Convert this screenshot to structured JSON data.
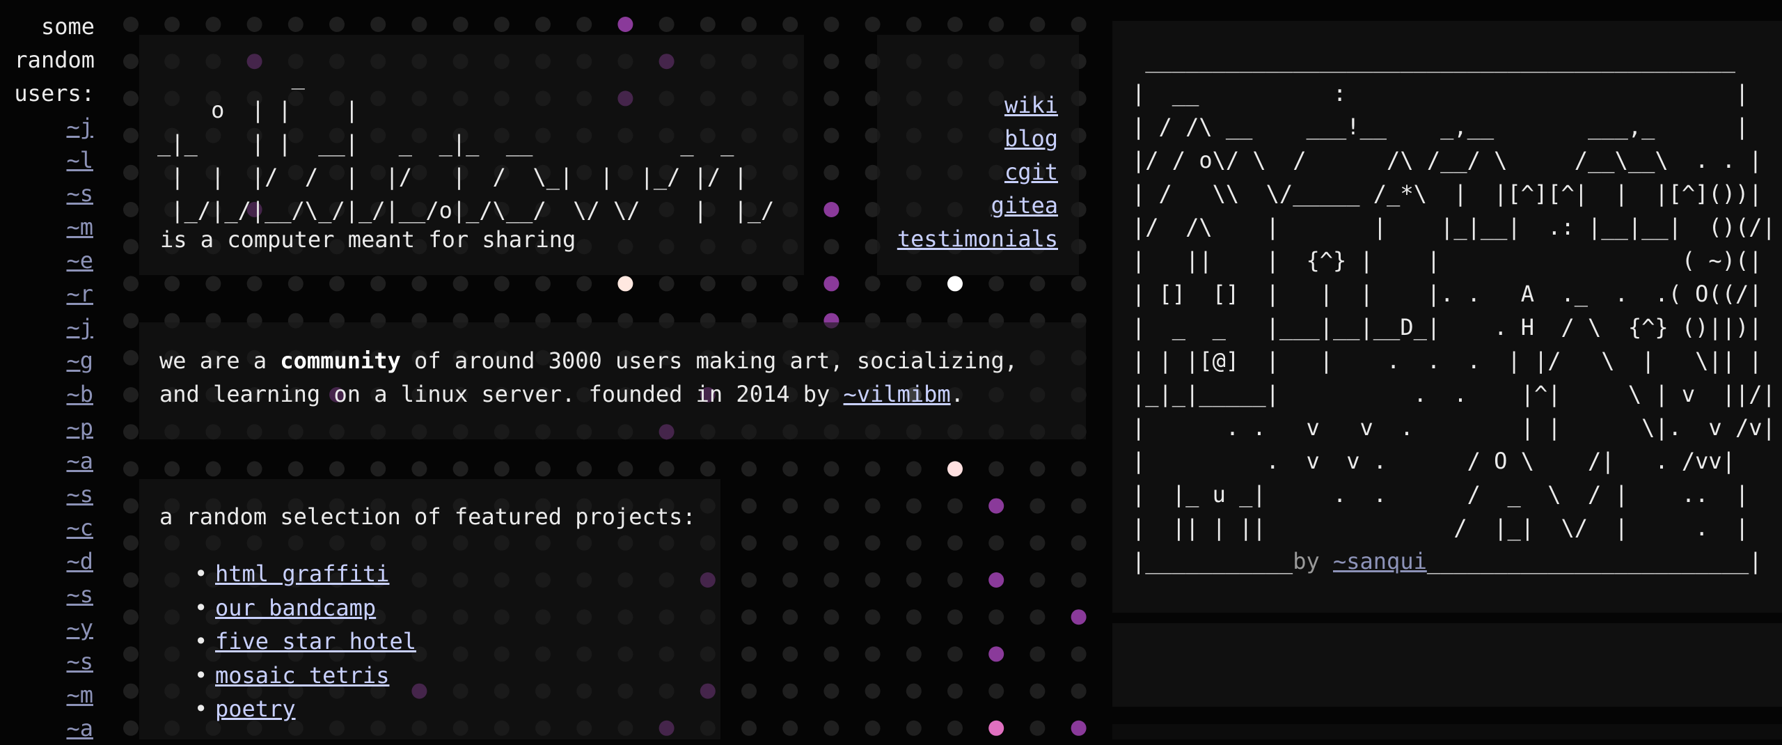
{
  "sidebar": {
    "title_lines": [
      "some",
      "random",
      "users:"
    ],
    "users": [
      "~j",
      "~l",
      "~s",
      "~m",
      "~e",
      "~r",
      "~j",
      "~g",
      "~b",
      "~p",
      "~a",
      "~s",
      "~c",
      "~d",
      "~s",
      "~y",
      "~s",
      "~m",
      "~a"
    ]
  },
  "header": {
    "logo_ascii": "          _\n    o  | |    |\n_|_    | |  __|   _  _|_  __           _  _\n |  |  |/  /  |  |/   |  /  \\_|  |  |_/ |/ |\n |_/|_/|__/\\_/|_/|__/o|_/\\__/  \\/ \\/    |  |_/",
    "tagline": "is a computer meant for sharing"
  },
  "nav": {
    "links": [
      "wiki",
      "blog",
      "cgit",
      "gitea",
      "testimonials"
    ]
  },
  "community": {
    "text_before": "we are a ",
    "bold": "community",
    "text_after": " of around 3000 users making art, socializing,",
    "line2": "and learning on a linux server. founded in 2014 by ",
    "founder": "~vilmibm",
    "end": "."
  },
  "projects": {
    "heading": "a random selection of featured projects:",
    "items": [
      "html graffiti",
      "our bandcamp",
      "five star hotel",
      "mosaic tetris",
      "poetry"
    ]
  },
  "art": {
    "ascii": " ____________________________________________\n|  __          :                             |\n| / /\\ __    ___!__    _,__       ___,_      |\n|/ / o\\/ \\  /      /\\ /__/ \\     /__\\__\\  . . |\n| /   \\\\  \\/_____ /_*\\  |  |[^][^|  |  |[^]())|\n|/  /\\    |       |    |_|__|  .: |__|__|  ()(/|\n|   ||    |  {^} |    |                  ( ~)(|\n| []  []  |   |  |    |. .   A  ._  .  .( O((/|\n|  _  _   |___|__|__D_|    . H  / \\  {^} ()||)|\n| | |[@]  |   |    .  .  .  | |/   \\  |   \\|| |\n|_|_|_____|          .  .    |^|     \\ | v  ||/|\n|      . .   v   v  .        | |      \\|.  v /v|\n|         .  v  v .      / O \\    /|   . /vv|\n|  |_ u _|     .  .      /  _  \\  / |    ..  |\n|  || | ||              /  |_|  \\/  |     .  |\n|___________",
    "credit_by": "by ",
    "credit_user": "~sanqui",
    "tail": "________________________|"
  },
  "colors": {
    "background": "#050505",
    "text": "#ebebeb",
    "link": "#c9d1ff",
    "dim_link": "#8d93b8",
    "dot": "#1f1f1f",
    "dot_purple": "#8a3a9a",
    "dot_pink": "#e070c0",
    "dot_white": "#ffffff"
  }
}
